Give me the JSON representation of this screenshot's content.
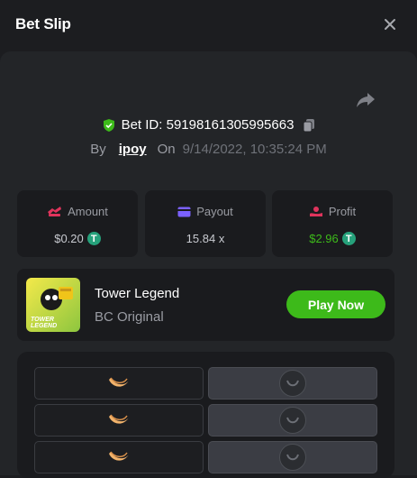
{
  "header": {
    "title": "Bet Slip",
    "close_icon": "close-icon"
  },
  "bet": {
    "id_label": "Bet ID: 5919816130599566​3",
    "by_label": "By",
    "user": "ipoy",
    "on_label": "On",
    "date": "9/14/2022, 10:35:24 PM"
  },
  "stats": {
    "amount": {
      "label": "Amount",
      "value": "$0.20",
      "icon": "amount-icon",
      "color": "#e0345c"
    },
    "payout": {
      "label": "Payout",
      "value": "15.84 x",
      "icon": "card-icon",
      "color": "#7b61ff"
    },
    "profit": {
      "label": "Profit",
      "value": "$2.96",
      "icon": "profit-icon",
      "color": "#e0345c",
      "value_color": "#3dba1a"
    }
  },
  "game": {
    "name": "Tower Legend",
    "provider": "BC Original",
    "play_label": "Play Now",
    "thumb_text": "TOWER LEGEND"
  },
  "colors": {
    "accent": "#3dba1a",
    "verified": "#3dba1a",
    "tether": "#26a17b"
  }
}
